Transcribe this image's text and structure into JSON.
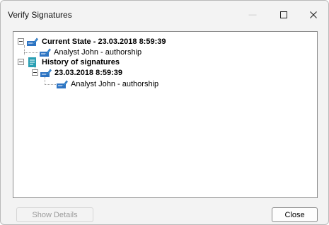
{
  "window": {
    "title": "Verify Signatures"
  },
  "titlebar": {
    "minimize_glyph": "—",
    "maximize_glyph": "☐",
    "close_glyph": "✕"
  },
  "tree": {
    "current_state": {
      "label": "Current State - 23.03.2018 8:59:39",
      "child_label": "Analyst John  - authorship"
    },
    "history": {
      "label": "History of signatures",
      "entry_label": "23.03.2018 8:59:39",
      "entry_child_label": "Analyst John  - authorship"
    }
  },
  "buttons": {
    "show_details": "Show Details",
    "close": "Close"
  },
  "icons": {
    "signature": "signature-icon",
    "document": "document-icon"
  }
}
